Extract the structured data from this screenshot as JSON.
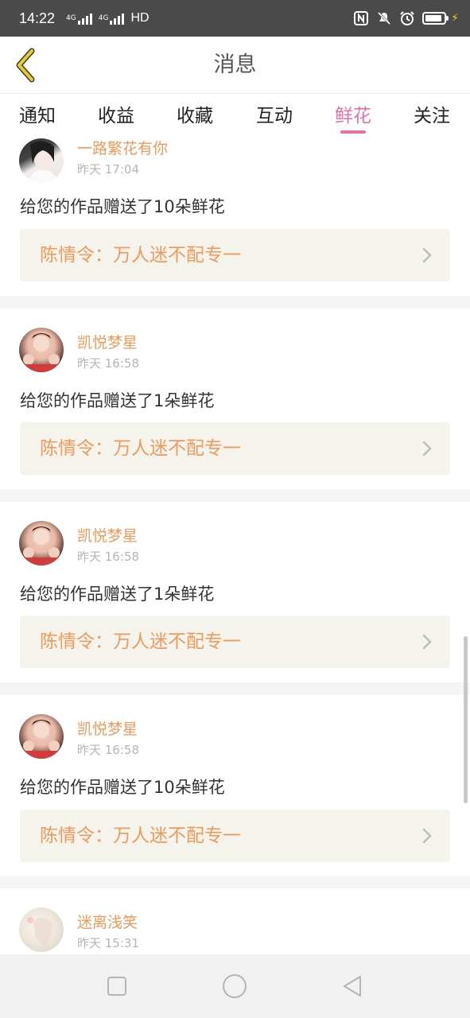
{
  "status_bar": {
    "time": "14:22",
    "network_1": "4G",
    "network_2": "4G",
    "hd": "HD",
    "icons": [
      "nfc-icon",
      "mute-icon",
      "alarm-icon",
      "battery-icon",
      "charging-icon"
    ]
  },
  "header": {
    "title": "消息",
    "back_icon": "chevron-left-icon"
  },
  "tabs": [
    {
      "label": "通知"
    },
    {
      "label": "收益"
    },
    {
      "label": "收藏"
    },
    {
      "label": "互动"
    },
    {
      "label": "鲜花",
      "active": true
    },
    {
      "label": "关注"
    }
  ],
  "messages": [
    {
      "user": "一路繁花有你",
      "time": "昨天 17:04",
      "text": "给您的作品赠送了10朵鲜花",
      "work": "陈情令：万人迷不配专一"
    },
    {
      "user": "凯悦梦星",
      "time": "昨天 16:58",
      "text": "给您的作品赠送了1朵鲜花",
      "work": "陈情令：万人迷不配专一"
    },
    {
      "user": "凯悦梦星",
      "time": "昨天 16:58",
      "text": "给您的作品赠送了1朵鲜花",
      "work": "陈情令：万人迷不配专一"
    },
    {
      "user": "凯悦梦星",
      "time": "昨天 16:58",
      "text": "给您的作品赠送了10朵鲜花",
      "work": "陈情令：万人迷不配专一"
    },
    {
      "user": "迷离浅笑",
      "time": "昨天 15:31"
    }
  ],
  "colors": {
    "accent_pink": "#e96fa3",
    "accent_orange": "#ef9a5a",
    "work_box_bg": "#f5f4ec",
    "back_icon_yellow": "#e8cc2a"
  },
  "navbar": {
    "icons": [
      "recent-apps-icon",
      "home-icon",
      "back-triangle-icon"
    ]
  }
}
